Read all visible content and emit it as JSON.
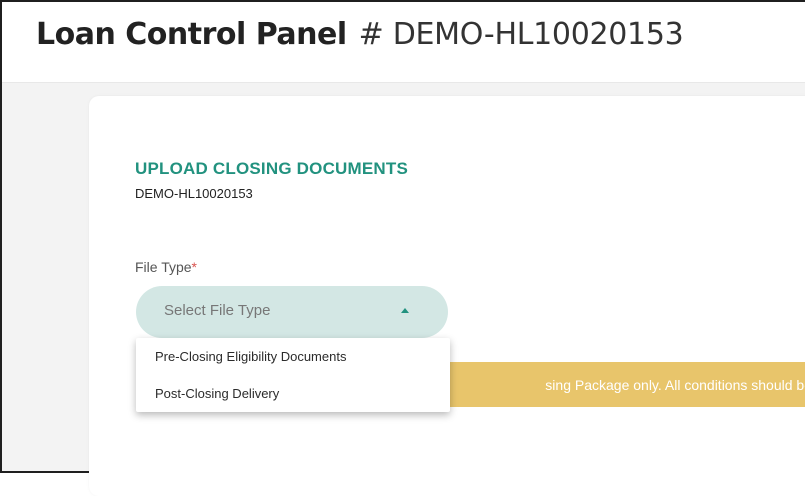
{
  "header": {
    "title": "Loan Control Panel",
    "loan_number": "# DEMO-HL10020153"
  },
  "upload": {
    "title": "UPLOAD CLOSING DOCUMENTS",
    "loan_id": "DEMO-HL10020153"
  },
  "file_type": {
    "label": "File Type",
    "required_mark": "*",
    "placeholder": "Select File Type",
    "options": [
      "Pre-Closing Eligibility Documents",
      "Post-Closing Delivery"
    ]
  },
  "notice": {
    "text_visible": "sing Package only. All conditions should be"
  },
  "colors": {
    "accent": "#22927f",
    "select_bg": "#d3e7e4",
    "notice_bg": "#e8c56b",
    "required": "#d9534f"
  },
  "icons": {
    "select_caret": "caret-up-icon"
  }
}
